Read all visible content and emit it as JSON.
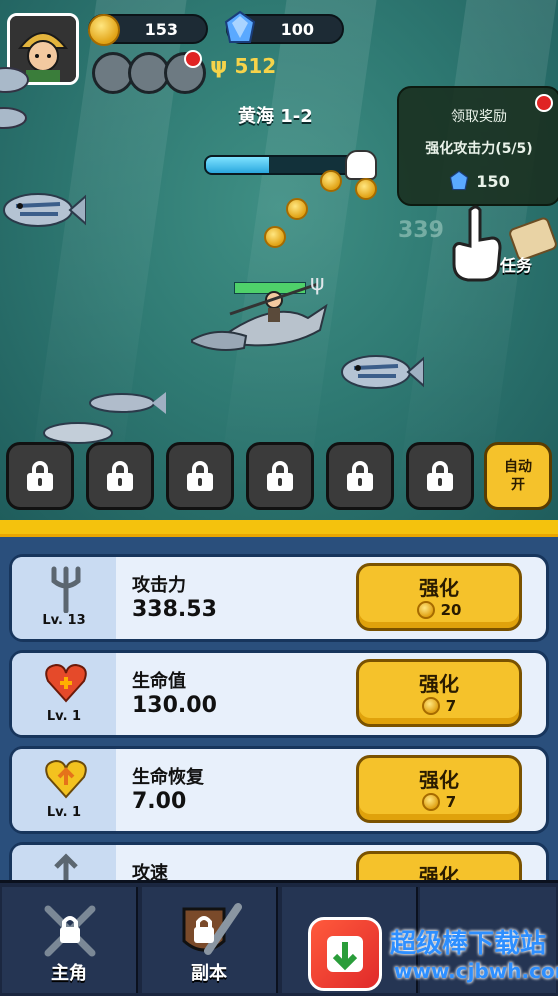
{
  "hud": {
    "gold": "153",
    "gems": "100",
    "power": "512",
    "stage": "黄海 1-2"
  },
  "reward_popup": {
    "title": "领取奖励",
    "task": "强化攻击力(5/5)",
    "reward": "150",
    "side_label": "任务"
  },
  "floating_damage": "339",
  "stage_progress": 0.42,
  "auto_button": {
    "line1": "自动",
    "line2": "开"
  },
  "upgrades": [
    {
      "icon": "trident-icon",
      "level": "Lv. 13",
      "name": "攻击力",
      "value": "338.53",
      "button": "强化",
      "cost": "20"
    },
    {
      "icon": "heart-icon",
      "level": "Lv. 1",
      "name": "生命值",
      "value": "130.00",
      "button": "强化",
      "cost": "7"
    },
    {
      "icon": "heart-up-icon",
      "level": "Lv. 1",
      "name": "生命恢复",
      "value": "7.00",
      "button": "强化",
      "cost": "7"
    },
    {
      "icon": "speed-icon",
      "level": "",
      "name": "攻速",
      "value": "",
      "button": "强化",
      "cost": ""
    }
  ],
  "nav": [
    {
      "label": "主角"
    },
    {
      "label": "副本"
    },
    {
      "label": ""
    },
    {
      "label": ""
    }
  ],
  "watermark": {
    "title": "超级棒下载站",
    "url": "www.cjbwh.com"
  },
  "colors": {
    "accent_yellow": "#f5c22b",
    "panel_blue": "#2a4f7c",
    "sea": "#2f7a73"
  }
}
